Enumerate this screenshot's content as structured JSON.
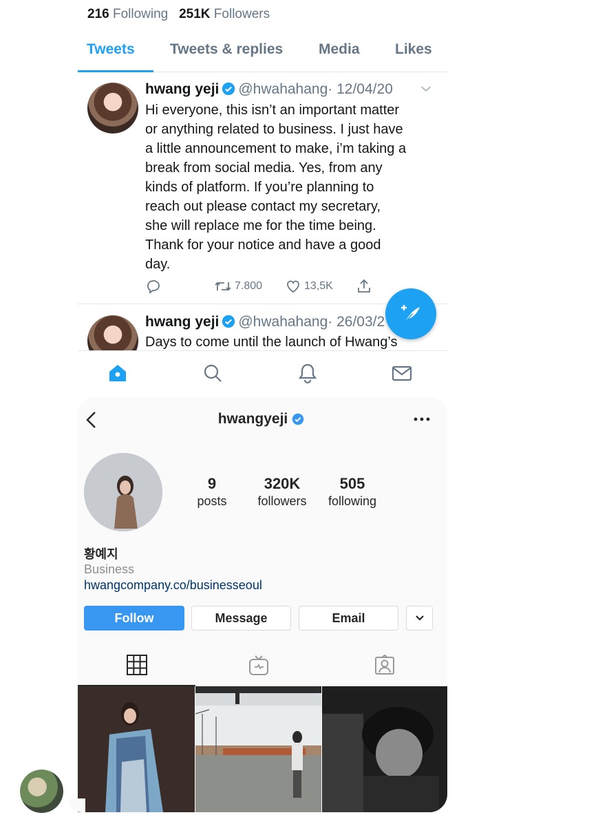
{
  "twitter": {
    "stats": {
      "following_count": "216",
      "following_label": "Following",
      "followers_count": "251K",
      "followers_label": "Followers"
    },
    "tabs": [
      "Tweets",
      "Tweets & replies",
      "Media",
      "Likes"
    ],
    "active_tab": "Tweets",
    "accent_color": "#1da1f2",
    "tweets": [
      {
        "name": "hwang yeji",
        "handle": "@hwahahang",
        "date": "· 12/04/20",
        "lines": [
          "Hi everyone, this isn’t an important matter",
          "or anything related to business. I just have",
          "a little announcement to make, i’m taking a",
          "break from social media. Yes, from any",
          "kinds of platform. If you’re planning to",
          "reach out please contact my secretary,",
          "she will replace me for the time being.",
          "Thank for your notice and have a good",
          "day."
        ],
        "retweets": "7.800",
        "likes": "13,5K"
      },
      {
        "name": "hwang yeji",
        "handle": "@hwahahang",
        "date": "· 26/03/2",
        "lines": [
          "Days to come until the launch of Hwang’s"
        ]
      }
    ],
    "nav_icons": [
      "home-icon",
      "search-icon",
      "bell-icon",
      "mail-icon"
    ]
  },
  "instagram": {
    "username": "hwangyeji",
    "stats": [
      {
        "value": "9",
        "label": "posts"
      },
      {
        "value": "320K",
        "label": "followers"
      },
      {
        "value": "505",
        "label": "following"
      }
    ],
    "bio_name": "황예지",
    "category": "Business",
    "link": "hwangcompany.co/businesseoul",
    "buttons": {
      "follow": "Follow",
      "message": "Message",
      "email": "Email"
    },
    "accent_color": "#3897f0",
    "tabs_icons": [
      "grid-icon",
      "igtv-icon",
      "tagged-icon"
    ]
  }
}
